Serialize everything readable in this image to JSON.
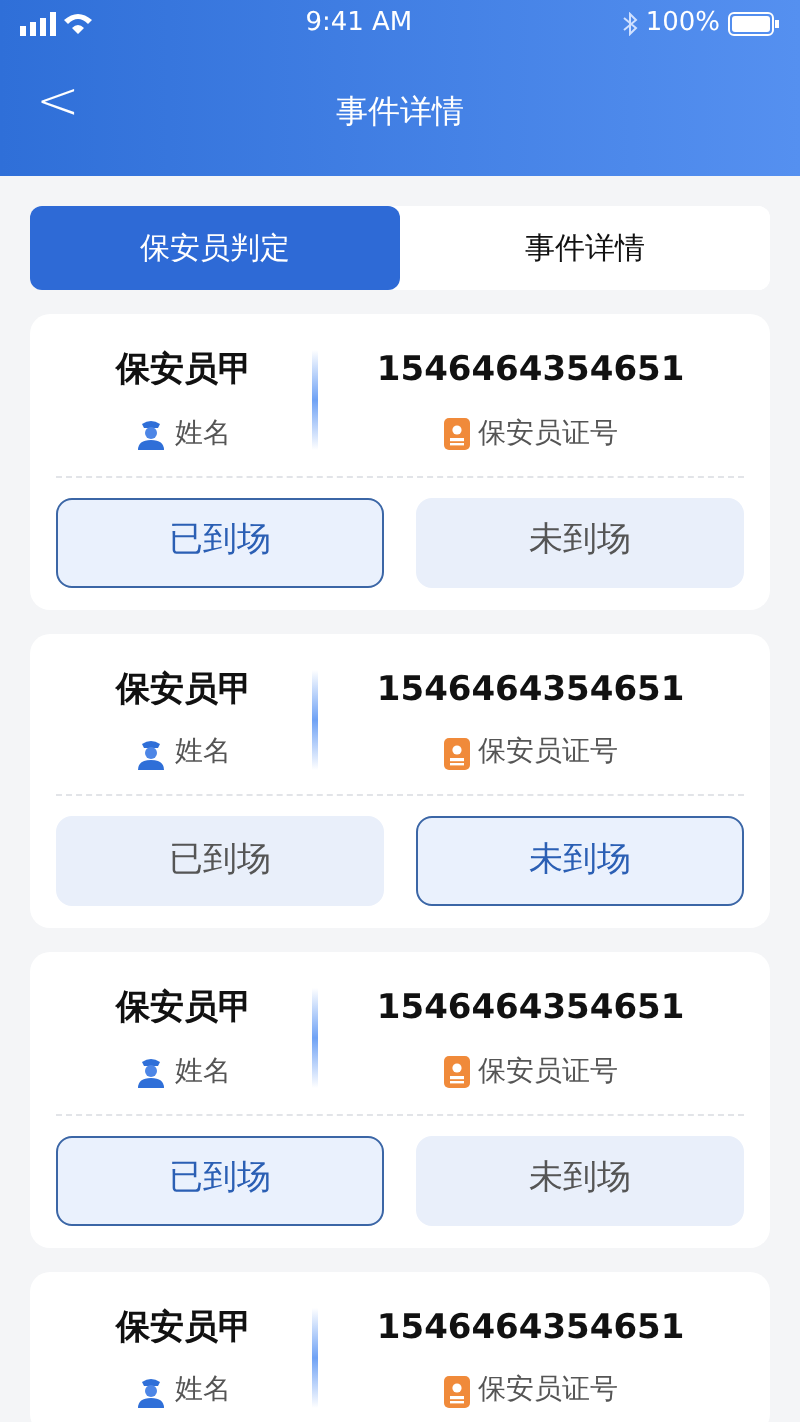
{
  "status_bar": {
    "time": "9:41 AM",
    "battery": "100%"
  },
  "header": {
    "back": "<",
    "title": "事件详情"
  },
  "tabs": [
    {
      "label": "保安员判定",
      "selected": true
    },
    {
      "label": "事件详情",
      "selected": false
    }
  ],
  "guards": [
    {
      "name": "保安员甲",
      "name_label": "姓名",
      "number": "1546464354651",
      "number_label": "保安员证号",
      "buttons": [
        {
          "label": "已到场",
          "selected": true
        },
        {
          "label": "未到场",
          "selected": false
        }
      ]
    },
    {
      "name": "保安员甲",
      "name_label": "姓名",
      "number": "1546464354651",
      "number_label": "保安员证号",
      "buttons": [
        {
          "label": "已到场",
          "selected": false
        },
        {
          "label": "未到场",
          "selected": true
        }
      ]
    },
    {
      "name": "保安员甲",
      "name_label": "姓名",
      "number": "1546464354651",
      "number_label": "保安员证号",
      "buttons": [
        {
          "label": "已到场",
          "selected": true
        },
        {
          "label": "未到场",
          "selected": false
        }
      ]
    },
    {
      "name": "保安员甲",
      "name_label": "姓名",
      "number": "1546464354651",
      "number_label": "保安员证号"
    }
  ]
}
